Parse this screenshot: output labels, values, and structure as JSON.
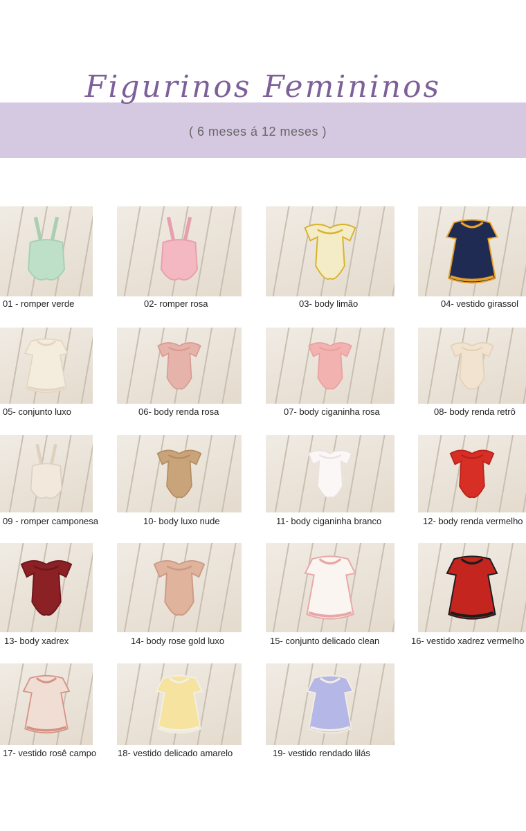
{
  "header": {
    "title": "Figurinos Femininos",
    "subtitle": "( 6 meses á 12 meses )"
  },
  "items": [
    {
      "label": "01 - romper verde",
      "garment": "romper",
      "color": "#bfe0c8",
      "accent": "#a9cfb3"
    },
    {
      "label": "02- romper rosa",
      "garment": "romper",
      "color": "#f4b8c3",
      "accent": "#e79fae"
    },
    {
      "label": "03- body limão",
      "garment": "body",
      "color": "#f4ecc6",
      "accent": "#d9b32c"
    },
    {
      "label": "04- vestido girassol",
      "garment": "dress",
      "color": "#1f2b52",
      "accent": "#e8a12a"
    },
    {
      "label": "05- conjunto luxo",
      "garment": "dress",
      "color": "#f4ecdd",
      "accent": "#e2d6c1"
    },
    {
      "label": "06-  body renda rosa",
      "garment": "body",
      "color": "#e6b3aa",
      "accent": "#d89a90"
    },
    {
      "label": "07- body ciganinha rosa",
      "garment": "body",
      "color": "#f1b2b0",
      "accent": "#e9a09e"
    },
    {
      "label": "08- body renda retrô",
      "garment": "body",
      "color": "#f1e3d0",
      "accent": "#e3d0b6"
    },
    {
      "label": "09 - romper camponesa",
      "garment": "romper",
      "color": "#f2e9dc",
      "accent": "#ddd0bd"
    },
    {
      "label": "10- body luxo nude",
      "garment": "body",
      "color": "#c9a47a",
      "accent": "#b58c60"
    },
    {
      "label": "11- body ciganinha branco",
      "garment": "body",
      "color": "#fbf7f6",
      "accent": "#e9e1df"
    },
    {
      "label": "12- body renda vermelho",
      "garment": "body",
      "color": "#d72f25",
      "accent": "#b82018"
    },
    {
      "label": "13- body xadrex",
      "garment": "body",
      "color": "#8c2125",
      "accent": "#6e171a"
    },
    {
      "label": "14- body rose gold luxo",
      "garment": "body",
      "color": "#e0b39d",
      "accent": "#cc9a84"
    },
    {
      "label": "15- conjunto delicado clean",
      "garment": "dress",
      "color": "#faf5f1",
      "accent": "#e8a7a7"
    },
    {
      "label": "16- vestido xadrez vermelho",
      "garment": "dress",
      "color": "#c4251f",
      "accent": "#1c1c1c"
    },
    {
      "label": "17- vestido rosê campo",
      "garment": "dress",
      "color": "#f0ddd3",
      "accent": "#d59283"
    },
    {
      "label": "18- vestido delicado amarelo",
      "garment": "dress",
      "color": "#f6e3a0",
      "accent": "#f1f0ea"
    },
    {
      "label": "19- vestido rendado lilás",
      "garment": "dress",
      "color": "#b5b8e6",
      "accent": "#f3eee2"
    }
  ]
}
